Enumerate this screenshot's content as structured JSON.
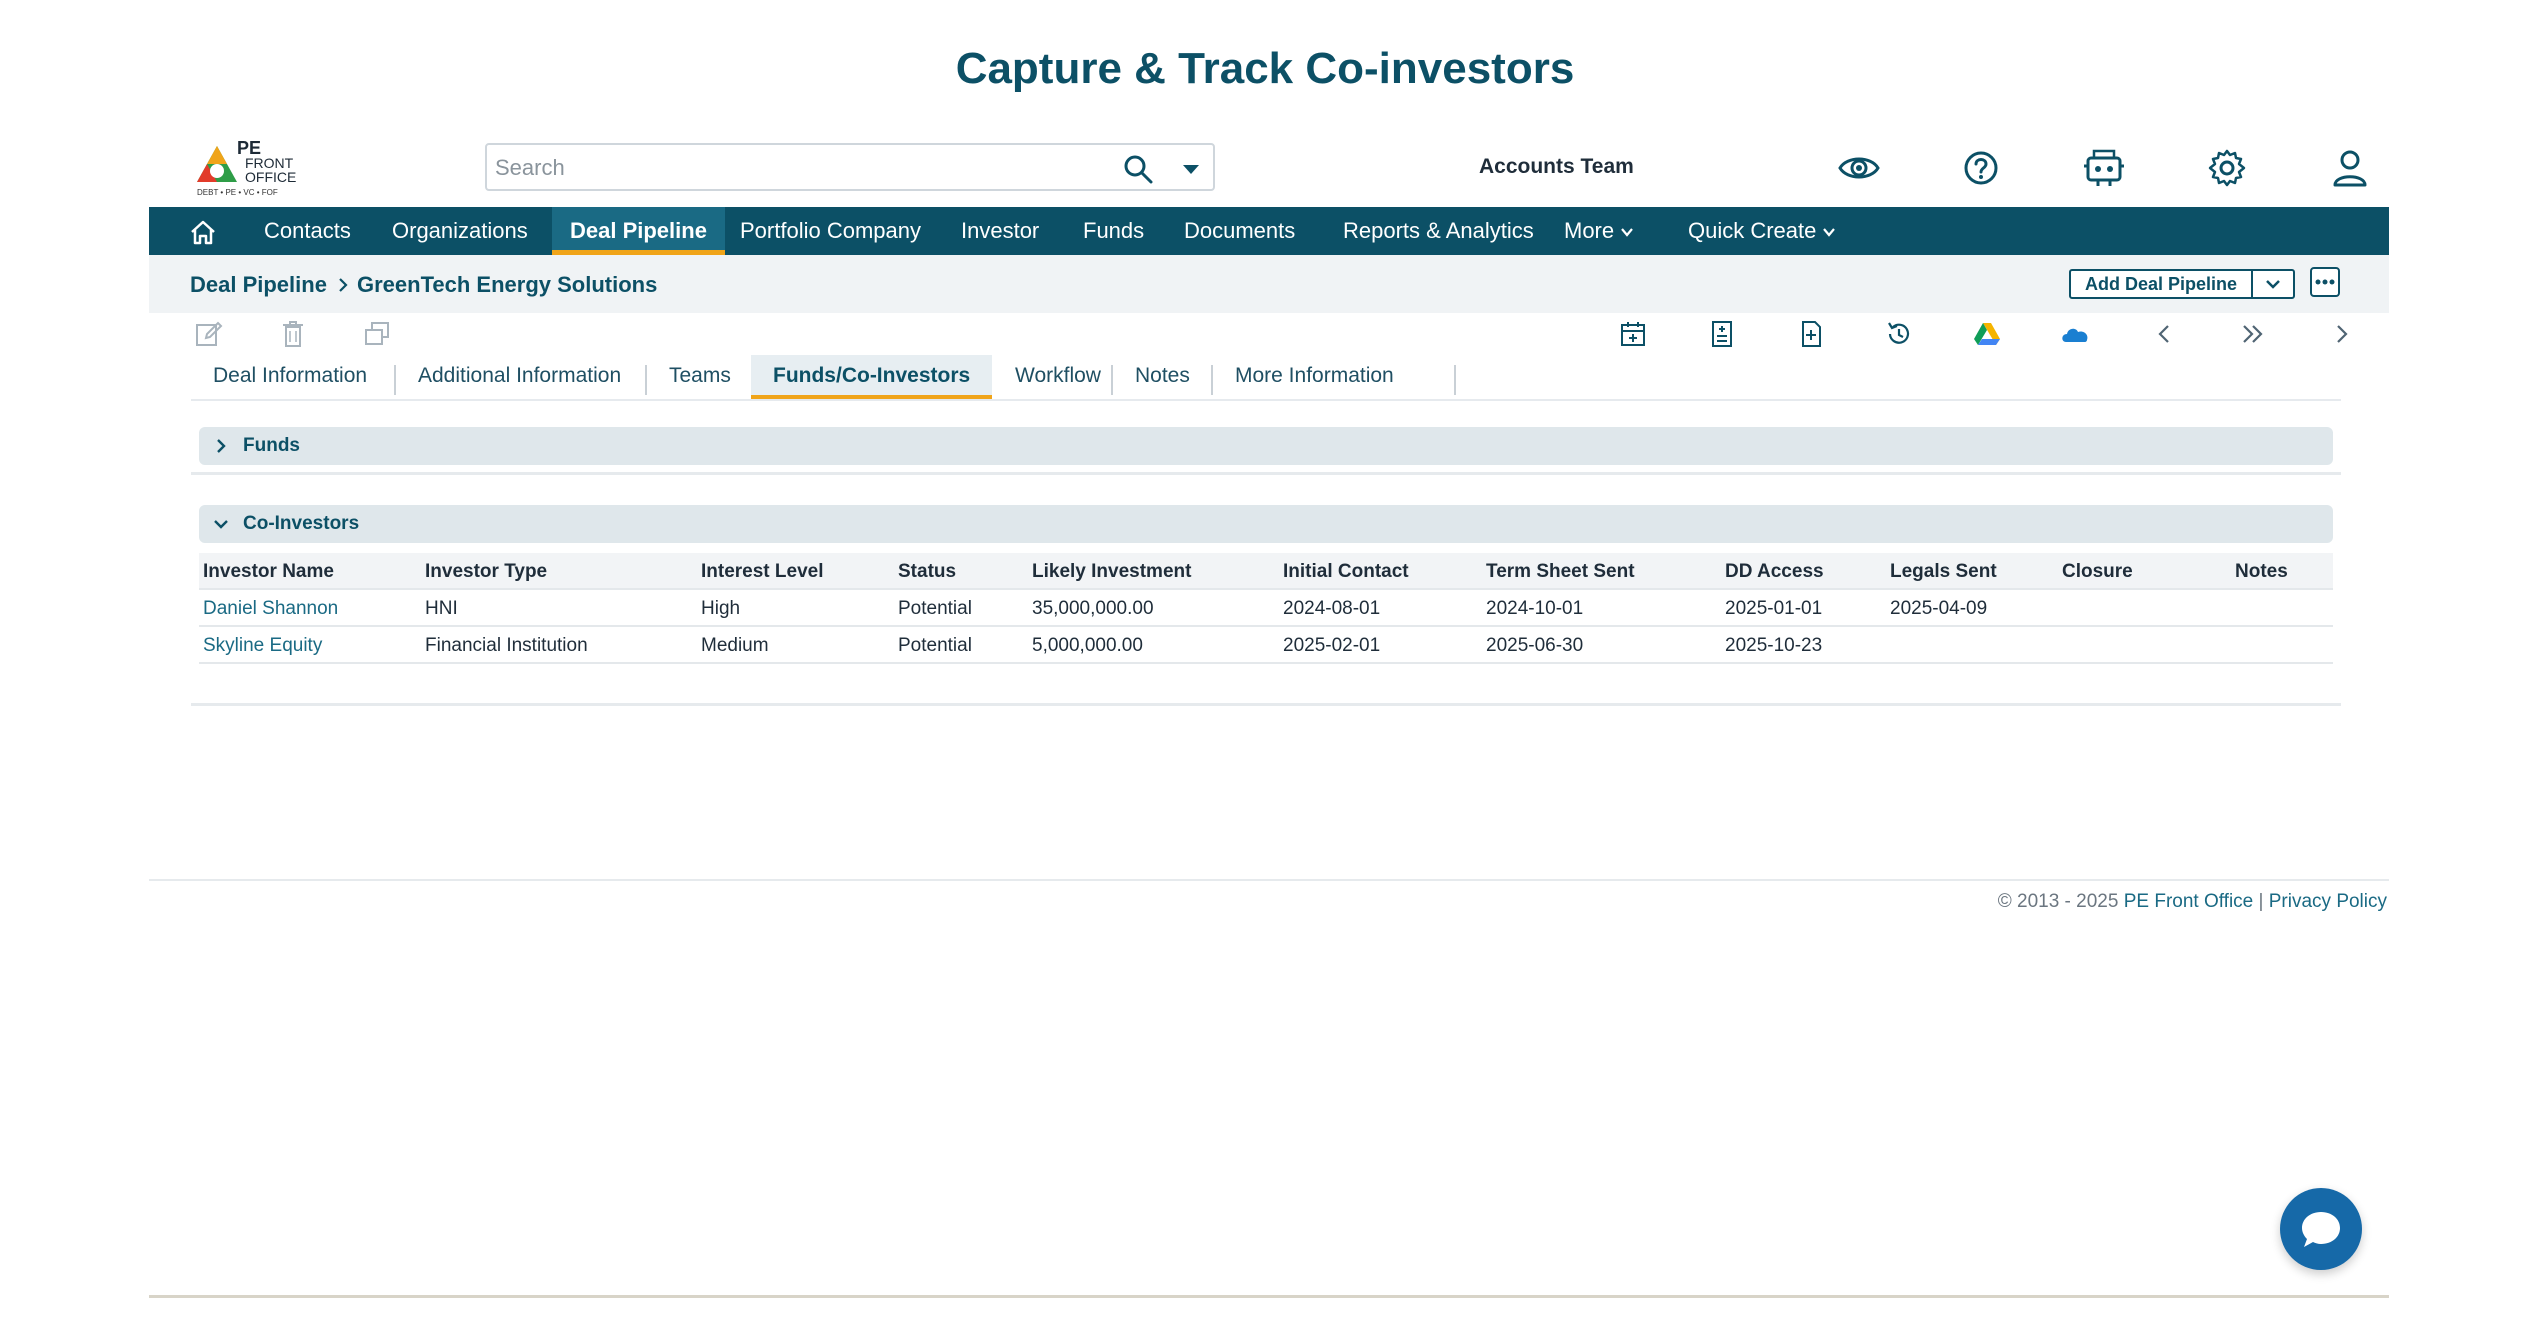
{
  "page_heading": "Capture & Track Co-investors",
  "logo": {
    "line1": "PE",
    "line2": "FRONT",
    "line3": "OFFICE",
    "tagline": "DEBT • PE • VC • FOF"
  },
  "search": {
    "placeholder": "Search",
    "value": ""
  },
  "team_name": "Accounts Team",
  "header_icons": [
    "eye-icon",
    "help-icon",
    "robot-icon",
    "settings-icon",
    "user-icon"
  ],
  "nav": {
    "items": [
      "Contacts",
      "Organizations",
      "Deal Pipeline",
      "Portfolio Company",
      "Investor",
      "Funds",
      "Documents",
      "Reports & Analytics",
      "More",
      "Quick Create"
    ],
    "active": "Deal Pipeline"
  },
  "breadcrumb": {
    "root": "Deal Pipeline",
    "current": "GreenTech Energy Solutions"
  },
  "actions": {
    "add_label": "Add Deal Pipeline"
  },
  "toolbar_icons": [
    "edit-icon",
    "delete-icon",
    "duplicate-icon",
    "calendar-icon",
    "calculator-icon",
    "document-icon",
    "history-icon",
    "google-drive-icon",
    "onedrive-icon",
    "previous-icon",
    "last-icon",
    "next-icon"
  ],
  "tabs": [
    "Deal Information",
    "Additional Information",
    "Teams",
    "Funds/Co-Investors",
    "Workflow",
    "Notes",
    "More Information"
  ],
  "active_tab": "Funds/Co-Investors",
  "funds_panel": {
    "title": "Funds",
    "expanded": false
  },
  "coinvestors_panel": {
    "title": "Co-Investors",
    "expanded": true,
    "columns": [
      "Investor Name",
      "Investor Type",
      "Interest Level",
      "Status",
      "Likely Investment",
      "Initial Contact",
      "Term Sheet Sent",
      "DD Access",
      "Legals Sent",
      "Closure",
      "Notes"
    ],
    "rows": [
      [
        "Daniel Shannon",
        "HNI",
        "High",
        "Potential",
        "35,000,000.00",
        "2024-08-01",
        "2024-10-01",
        "2025-01-01",
        "2025-04-09",
        "",
        ""
      ],
      [
        "Skyline Equity",
        "Financial Institution",
        "Medium",
        "Potential",
        "5,000,000.00",
        "2025-02-01",
        "2025-06-30",
        "2025-10-23",
        "",
        "",
        ""
      ]
    ]
  },
  "footer": {
    "copyright": "© 2013 - 2025",
    "company": "PE Front Office",
    "separator": "|",
    "privacy": "Privacy Policy"
  },
  "colors": {
    "brand": "#0c5066",
    "accent": "#f0a419",
    "link": "#1a6a84",
    "chat": "#1669a8"
  }
}
